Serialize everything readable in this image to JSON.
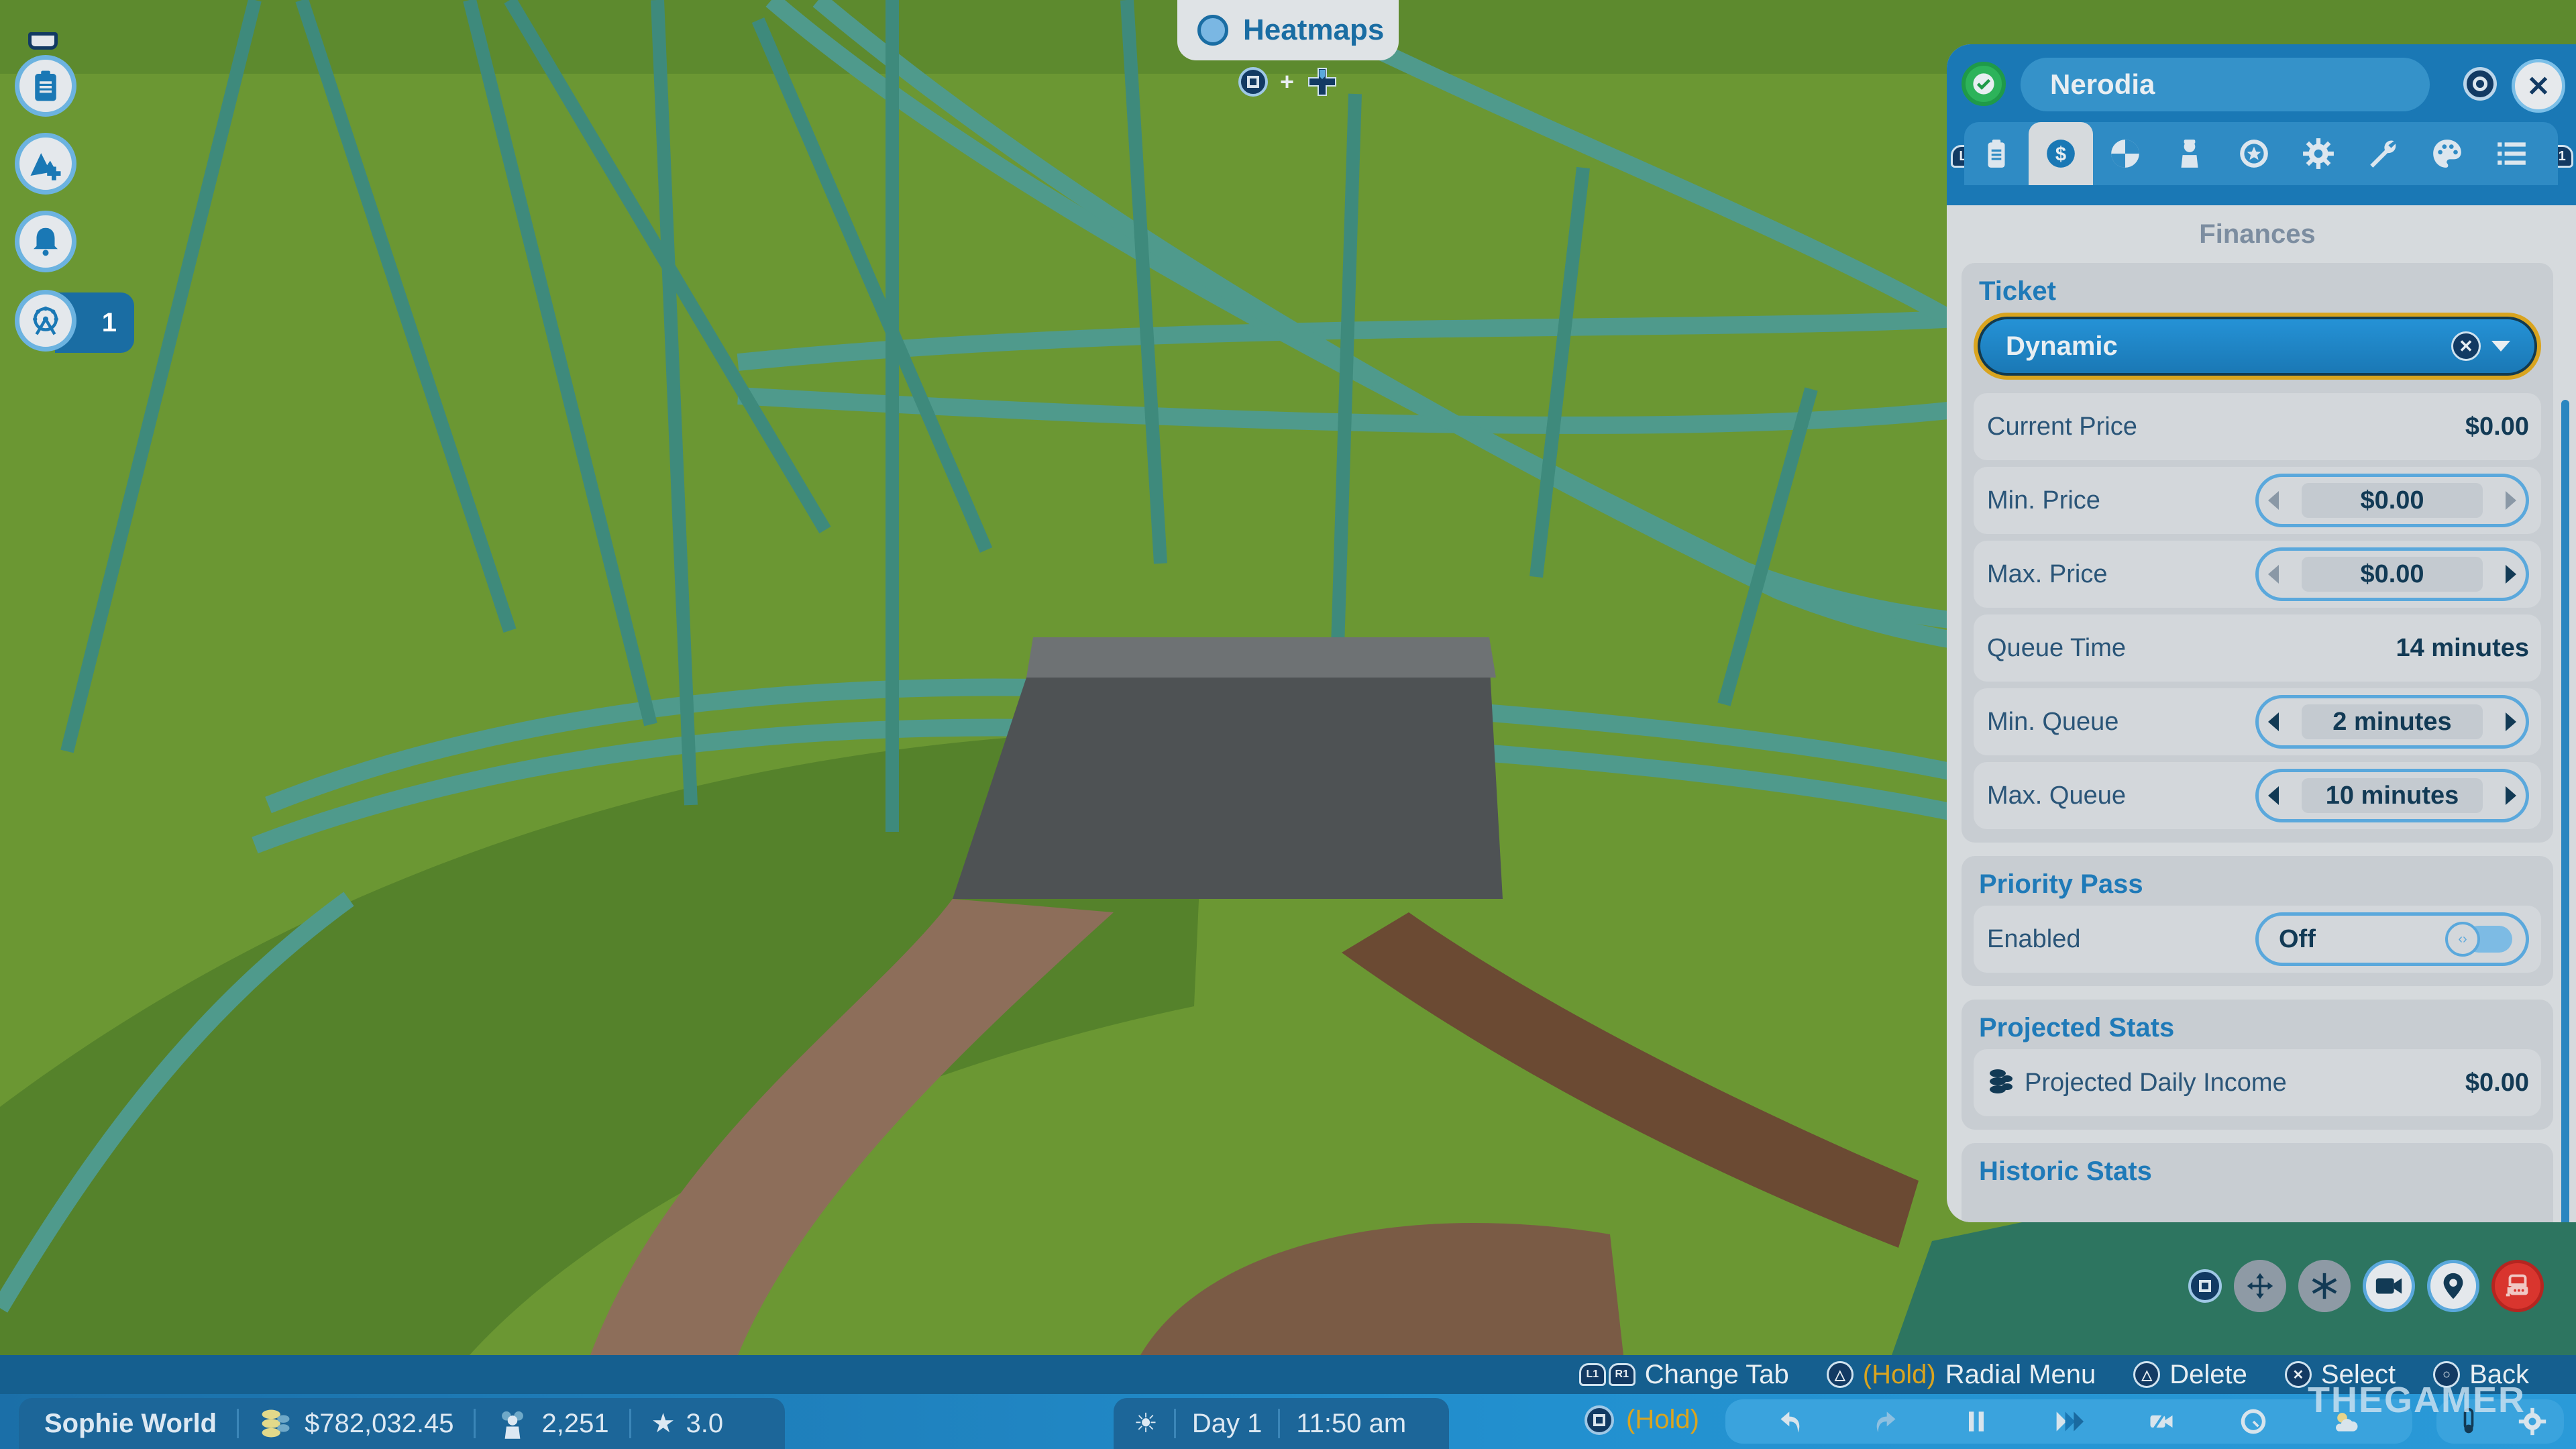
{
  "heatmaps": {
    "label": "Heatmaps",
    "shortcut_plus": "+"
  },
  "left_toolbar": {
    "items": [
      {
        "name": "tray-icon"
      },
      {
        "name": "park-management-icon"
      },
      {
        "name": "scenery-add-icon"
      },
      {
        "name": "notifications-icon"
      },
      {
        "name": "rides-icon",
        "badge": "1"
      }
    ]
  },
  "panel": {
    "ride_name": "Nerodia",
    "tab_left_key": "L1",
    "tab_right_key": "R1",
    "tabs": [
      "overview",
      "finances",
      "stats",
      "staff",
      "rating",
      "settings",
      "maintenance",
      "paint",
      "list"
    ],
    "active_tab": "finances",
    "section_title": "Finances",
    "ticket": {
      "header": "Ticket",
      "mode": "Dynamic",
      "current_price_label": "Current Price",
      "current_price": "$0.00",
      "min_price_label": "Min. Price",
      "min_price": "$0.00",
      "max_price_label": "Max. Price",
      "max_price": "$0.00",
      "queue_time_label": "Queue Time",
      "queue_time": "14 minutes",
      "min_queue_label": "Min. Queue",
      "min_queue": "2 minutes",
      "max_queue_label": "Max. Queue",
      "max_queue": "10 minutes"
    },
    "priority_pass": {
      "header": "Priority Pass",
      "enabled_label": "Enabled",
      "enabled_value": "Off"
    },
    "projected_stats": {
      "header": "Projected Stats",
      "daily_income_label": "Projected Daily Income",
      "daily_income": "$0.00"
    },
    "historic_stats": {
      "header": "Historic Stats"
    }
  },
  "camera_tools": [
    "square-button",
    "move",
    "multi-direction",
    "camera",
    "location-pin",
    "ride-vehicle"
  ],
  "hints": {
    "change_tab": "Change Tab",
    "change_tab_keys": [
      "L1",
      "R1"
    ],
    "hold": "(Hold)",
    "radial_menu": "Radial Menu",
    "delete": "Delete",
    "select": "Select",
    "back": "Back"
  },
  "status": {
    "park_name": "Sophie World",
    "money": "$782,032.45",
    "guests": "2,251",
    "rating": "3.0",
    "day": "Day 1",
    "time": "11:50 am",
    "hold": "(Hold)"
  },
  "watermark": "THEGAMER"
}
